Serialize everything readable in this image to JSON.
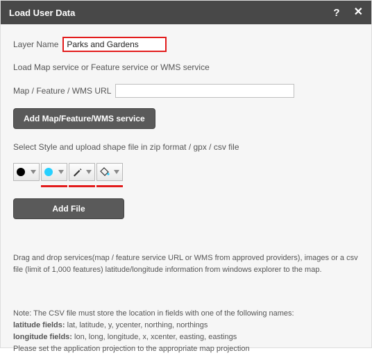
{
  "titlebar": {
    "title": "Load User Data",
    "help_glyph": "?",
    "close_glyph": "✕"
  },
  "layer": {
    "label": "Layer Name",
    "value": "Parks and Gardens"
  },
  "service_hint": "Load Map service or Feature service or WMS service",
  "url": {
    "label": "Map / Feature / WMS URL",
    "value": ""
  },
  "add_service_btn": "Add Map/Feature/WMS service",
  "style_hint": "Select Style and upload shape file in zip format / gpx / csv file",
  "add_file_btn": "Add File",
  "drag_info": "Drag and drop services(map / feature service URL or WMS from approved providers), images or a csv file (limit of 1,000 features) latitude/longitude information from windows explorer to the map.",
  "note": {
    "line1": "Note: The CSV file must store the location in fields with one of the following names:",
    "lat_label": "latitude fields:",
    "lat_values": " lat, latitude, y, ycenter, northing, northings",
    "lon_label": "longitude fields:",
    "lon_values": " lon, long, longitude, x, xcenter, easting, eastings",
    "line4": "Please set the application projection to the appropriate map projection"
  }
}
